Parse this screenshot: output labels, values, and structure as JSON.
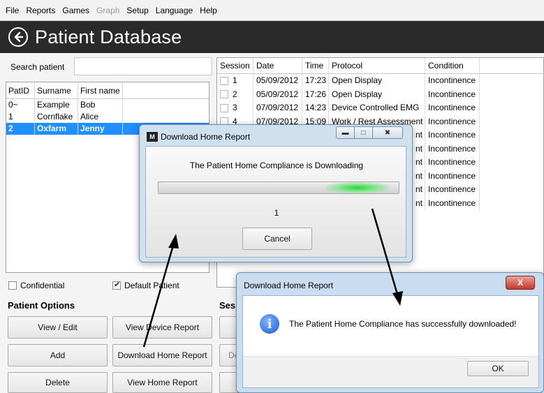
{
  "menu": [
    "File",
    "Reports",
    "Games",
    "Graph",
    "Setup",
    "Language",
    "Help"
  ],
  "menu_disabled": [
    "Graph"
  ],
  "title": "Patient Database",
  "search": {
    "label": "Search patient",
    "value": ""
  },
  "patients": {
    "headers": [
      "PatID",
      "Surname",
      "First name"
    ],
    "rows": [
      {
        "id": "0~",
        "surname": "Example",
        "first": "Bob"
      },
      {
        "id": "1",
        "surname": "Cornflake",
        "first": "Alice"
      },
      {
        "id": "2",
        "surname": "Oxfarm",
        "first": "Jenny"
      }
    ],
    "selected_index": 2
  },
  "checkboxes": {
    "confidential": {
      "label": "Confidential",
      "checked": false
    },
    "default_patient": {
      "label": "Default Patient",
      "checked": true
    }
  },
  "patient_options": {
    "title": "Patient Options",
    "buttons": [
      "View / Edit",
      "View Device Report",
      "Add",
      "Download Home Report",
      "Delete",
      "View Home Report"
    ]
  },
  "session_title_visible": "Sess",
  "session_buttons_partial": [
    "",
    "De",
    ""
  ],
  "sessions": {
    "headers": [
      "Session",
      "Date",
      "Time",
      "Protocol",
      "Condition"
    ],
    "rows": [
      {
        "session": "1",
        "date": "05/09/2012",
        "time": "17:23",
        "protocol": "Open Display",
        "condition": "Incontinence"
      },
      {
        "session": "2",
        "date": "05/09/2012",
        "time": "17:26",
        "protocol": "Open Display",
        "condition": "Incontinence"
      },
      {
        "session": "3",
        "date": "07/09/2012",
        "time": "14:23",
        "protocol": "Device Controlled EMG",
        "condition": "Incontinence"
      },
      {
        "session": "4",
        "date": "07/09/2012",
        "time": "15:09",
        "protocol": "Work / Rest Assessment",
        "condition": "Incontinence"
      },
      {
        "session": "",
        "date": "",
        "time": "",
        "protocol": "nt",
        "condition": "Incontinence"
      },
      {
        "session": "",
        "date": "",
        "time": "",
        "protocol": "nt",
        "condition": "Incontinence"
      },
      {
        "session": "",
        "date": "",
        "time": "",
        "protocol": "nt",
        "condition": "Incontinence"
      },
      {
        "session": "",
        "date": "",
        "time": "",
        "protocol": "nt",
        "condition": "Incontinence"
      },
      {
        "session": "",
        "date": "",
        "time": "",
        "protocol": "nt",
        "condition": "Incontinence"
      },
      {
        "session": "",
        "date": "",
        "time": "",
        "protocol": "nt",
        "condition": "Incontinence"
      }
    ]
  },
  "download_dialog": {
    "title": "Download Home Report",
    "message": "The Patient Home Compliance is Downloading",
    "count": "1",
    "cancel_label": "Cancel",
    "caption_buttons": [
      "minimize",
      "maximize",
      "close"
    ]
  },
  "success_dialog": {
    "title": "Download Home Report",
    "message": "The Patient Home Compliance has successfully downloaded!",
    "ok_label": "OK",
    "close_label": "X"
  },
  "colors": {
    "accent_selected": "#1e90ff",
    "titlebar": "#2a2a2a",
    "progress_glow": "#27d83b"
  }
}
